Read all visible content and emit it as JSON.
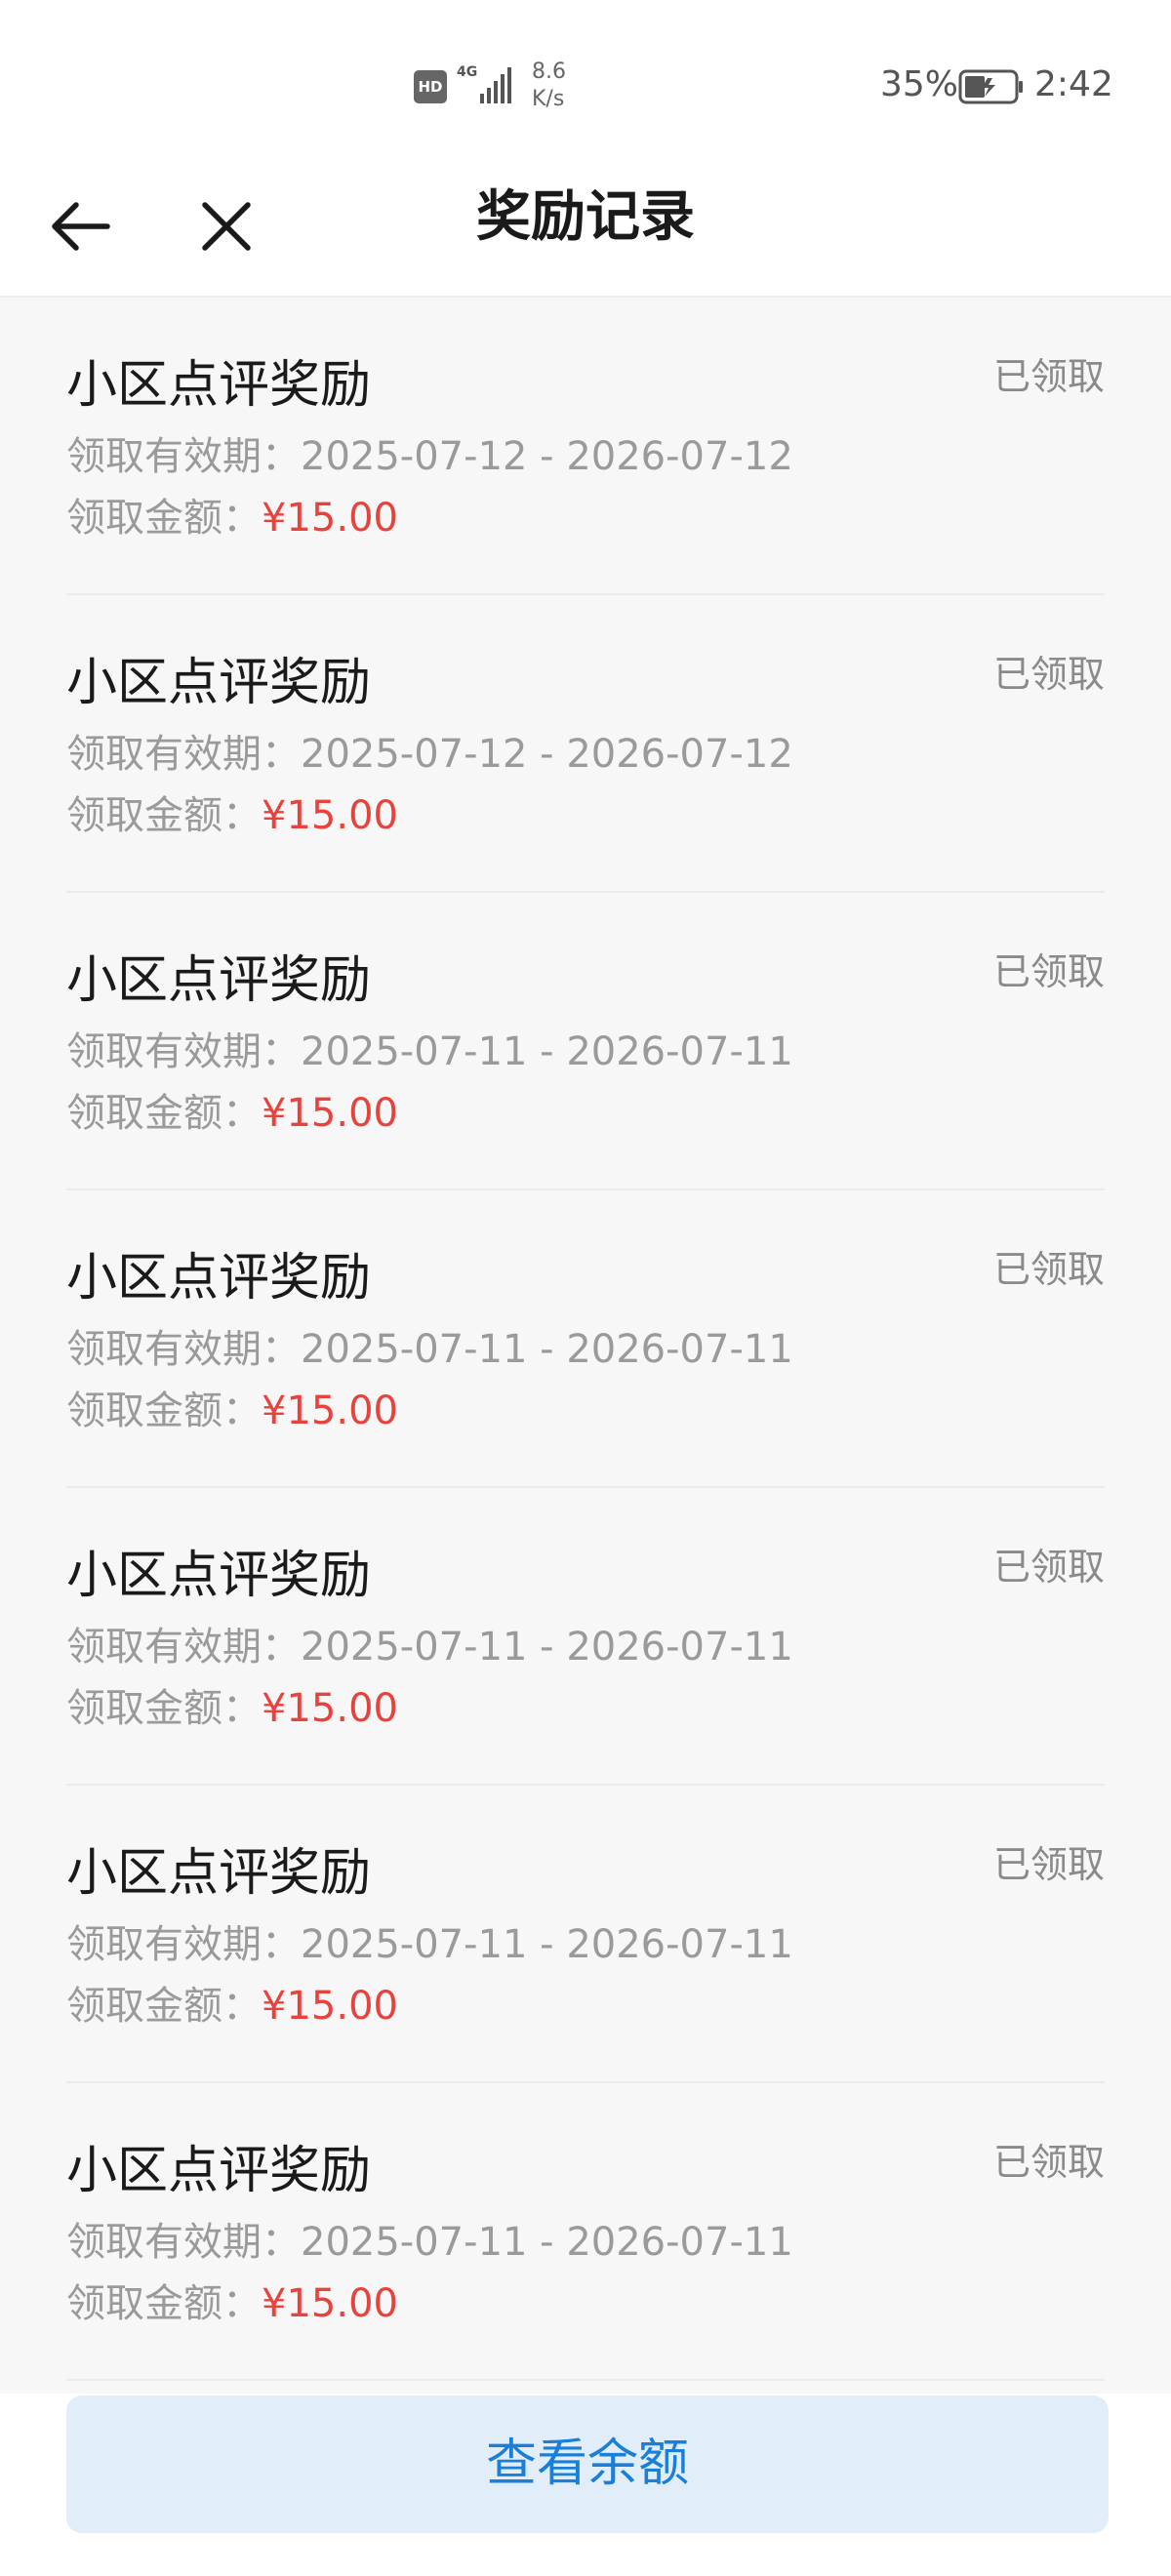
{
  "status_bar": {
    "hd": "HD",
    "network": "4G",
    "speed_value": "8.6",
    "speed_unit": "K/s",
    "battery": "35%",
    "time": "2:42"
  },
  "nav": {
    "title": "奖励记录",
    "back_icon": "arrow-left-icon",
    "close_icon": "close-icon"
  },
  "records": [
    {
      "title": "小区点评奖励",
      "status": "已领取",
      "validity_label": "领取有效期：",
      "validity": "2025-07-12 - 2026-07-12",
      "amount_label": "领取金额：",
      "amount": "¥15.00"
    },
    {
      "title": "小区点评奖励",
      "status": "已领取",
      "validity_label": "领取有效期：",
      "validity": "2025-07-12 - 2026-07-12",
      "amount_label": "领取金额：",
      "amount": "¥15.00"
    },
    {
      "title": "小区点评奖励",
      "status": "已领取",
      "validity_label": "领取有效期：",
      "validity": "2025-07-11 - 2026-07-11",
      "amount_label": "领取金额：",
      "amount": "¥15.00"
    },
    {
      "title": "小区点评奖励",
      "status": "已领取",
      "validity_label": "领取有效期：",
      "validity": "2025-07-11 - 2026-07-11",
      "amount_label": "领取金额：",
      "amount": "¥15.00"
    },
    {
      "title": "小区点评奖励",
      "status": "已领取",
      "validity_label": "领取有效期：",
      "validity": "2025-07-11 - 2026-07-11",
      "amount_label": "领取金额：",
      "amount": "¥15.00"
    },
    {
      "title": "小区点评奖励",
      "status": "已领取",
      "validity_label": "领取有效期：",
      "validity": "2025-07-11 - 2026-07-11",
      "amount_label": "领取金额：",
      "amount": "¥15.00"
    },
    {
      "title": "小区点评奖励",
      "status": "已领取",
      "validity_label": "领取有效期：",
      "validity": "2025-07-11 - 2026-07-11",
      "amount_label": "领取金额：",
      "amount": "¥15.00"
    }
  ],
  "bottom": {
    "button_label": "查看余额"
  },
  "colors": {
    "amount": "#e8423d",
    "button_bg": "#e1edf9",
    "button_text": "#1a7fd8",
    "background": "#f7f7f7"
  }
}
